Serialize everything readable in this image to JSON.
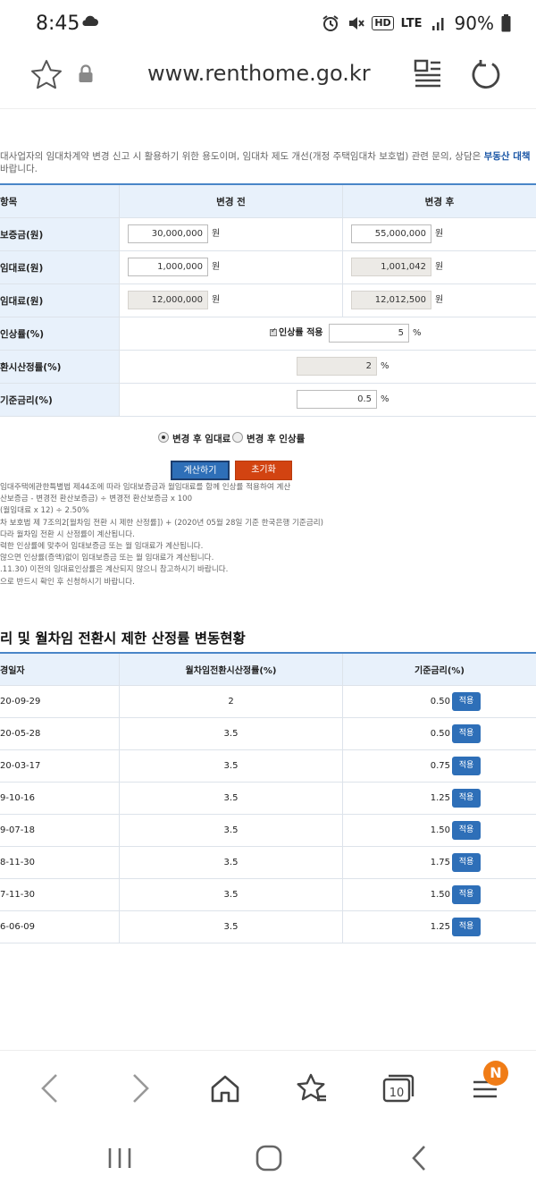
{
  "status": {
    "time": "8:45",
    "battery": "90%",
    "hd": "HD",
    "lte": "LTE"
  },
  "browser": {
    "url": "www.renthome.go.kr",
    "tab_count": "10",
    "notification_badge": "N"
  },
  "intro": {
    "line1_text": "대사업자의 임대차계약 변경 신고 시 활용하기 위한 용도이며, 임대차 제도 개선(개정 주택임대차 보호법) 관련 문의, 상담은 ",
    "line1_link": "부동산 대책",
    "line2": "바랍니다."
  },
  "calc": {
    "headers": {
      "item": "항목",
      "before": "변경 전",
      "after": "변경 후"
    },
    "rows": {
      "deposit": {
        "label": "보증금(원)",
        "before": "30,000,000",
        "after": "55,000,000",
        "unit": "원"
      },
      "monthly": {
        "label": "임대료(원)",
        "before": "1,000,000",
        "after": "1,001,042",
        "unit": "원"
      },
      "annual": {
        "label": "임대료(원)",
        "before": "12,000,000",
        "after": "12,012,500",
        "unit": "원"
      },
      "increase": {
        "label": "인상률(%)",
        "check_label": "인상률 적용",
        "value": "5",
        "unit": "%"
      },
      "conversion": {
        "label": "환시산정률(%)",
        "value": "2",
        "unit": "%"
      },
      "base_rate": {
        "label": "기준금리(%)",
        "value": "0.5",
        "unit": "%"
      }
    },
    "radio": {
      "opt1": "변경 후 임대료",
      "opt2": "변경 후 인상률"
    },
    "buttons": {
      "calculate": "계산하기",
      "reset": "초기화"
    },
    "notes": [
      "임대주택에관한특별법 제44조에 따라 임대보증금과 월임대료를 함께 인상률 적용하여 계산",
      "산보증금 - 변경전 환산보증금) ÷ 변경전 환산보증금 x 100",
      "(월임대료 x 12) ÷ 2.50%",
      "차 보호법 제 7조의2[월차임 전환 시 제한 산정률]) + (2020년 05월 28일 기준 한국은행 기준금리)",
      "다라 월차임 전환 시 산정률이 계산됩니다.",
      "력한 인상률에 맞추어 임대보증금 또는 월 임대료가 계산됩니다.",
      "않으면 인상률(증액)없이 임대보증금 또는 월 임대료가 계산됩니다.",
      ".11.30) 이전의 임대료인상률은 계산되지 않으니 참고하시기 바랍니다.",
      "으로 반드시 확인 후 신청하시기 바랍니다."
    ]
  },
  "history": {
    "title": "리 및 월차임 전환시 제한 산정률 변동현황",
    "headers": {
      "date": "경일자",
      "conversion": "월차임전환시산정률(%)",
      "base_rate": "기준금리(%)"
    },
    "apply_label": "적용",
    "rows": [
      {
        "date": "20-09-29",
        "conversion": "2",
        "base_rate": "0.50"
      },
      {
        "date": "20-05-28",
        "conversion": "3.5",
        "base_rate": "0.50"
      },
      {
        "date": "20-03-17",
        "conversion": "3.5",
        "base_rate": "0.75"
      },
      {
        "date": "9-10-16",
        "conversion": "3.5",
        "base_rate": "1.25"
      },
      {
        "date": "9-07-18",
        "conversion": "3.5",
        "base_rate": "1.50"
      },
      {
        "date": "8-11-30",
        "conversion": "3.5",
        "base_rate": "1.75"
      },
      {
        "date": "7-11-30",
        "conversion": "3.5",
        "base_rate": "1.50"
      },
      {
        "date": "6-06-09",
        "conversion": "3.5",
        "base_rate": "1.25"
      }
    ]
  },
  "colors": {
    "accent_blue": "#2e6fb8",
    "reset_red": "#d24311",
    "header_bg": "#e8f1fb",
    "badge_orange": "#f07c16"
  },
  "icons": {
    "status": [
      "cloud-icon",
      "alarm-icon",
      "mute-icon",
      "signal-icon",
      "battery-icon"
    ],
    "address_bar": [
      "star-icon",
      "lock-icon",
      "reader-mode-icon",
      "reload-icon"
    ],
    "browser_nav": [
      "back-icon",
      "forward-icon",
      "home-icon",
      "bookmarks-icon",
      "tabs-icon",
      "menu-icon"
    ],
    "system_nav": [
      "recents-icon",
      "home-button-icon",
      "back-button-icon"
    ]
  }
}
